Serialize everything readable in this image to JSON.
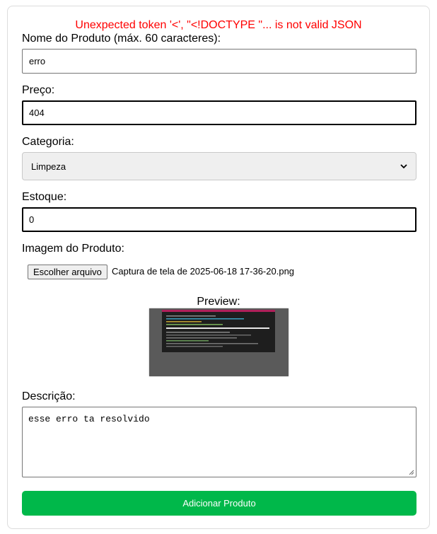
{
  "error_message": "Unexpected token '<', \"<!DOCTYPE \"... is not valid JSON",
  "form": {
    "name": {
      "label": "Nome do Produto (máx. 60 caracteres):",
      "value": "erro"
    },
    "price": {
      "label": "Preço:",
      "value": "404"
    },
    "category": {
      "label": "Categoria:",
      "selected": "Limpeza"
    },
    "stock": {
      "label": "Estoque:",
      "value": "0"
    },
    "image": {
      "label": "Imagem do Produto:",
      "button": "Escolher arquivo",
      "file_name": "Captura de tela de 2025-06-18 17-36-20.png",
      "preview_label": "Preview:"
    },
    "description": {
      "label": "Descrição:",
      "value": "esse erro ta resolvido"
    },
    "submit": "Adicionar Produto"
  },
  "colors": {
    "error": "#ff0000",
    "submit_bg": "#00b84a",
    "preview_bg": "#5a5a5a"
  }
}
